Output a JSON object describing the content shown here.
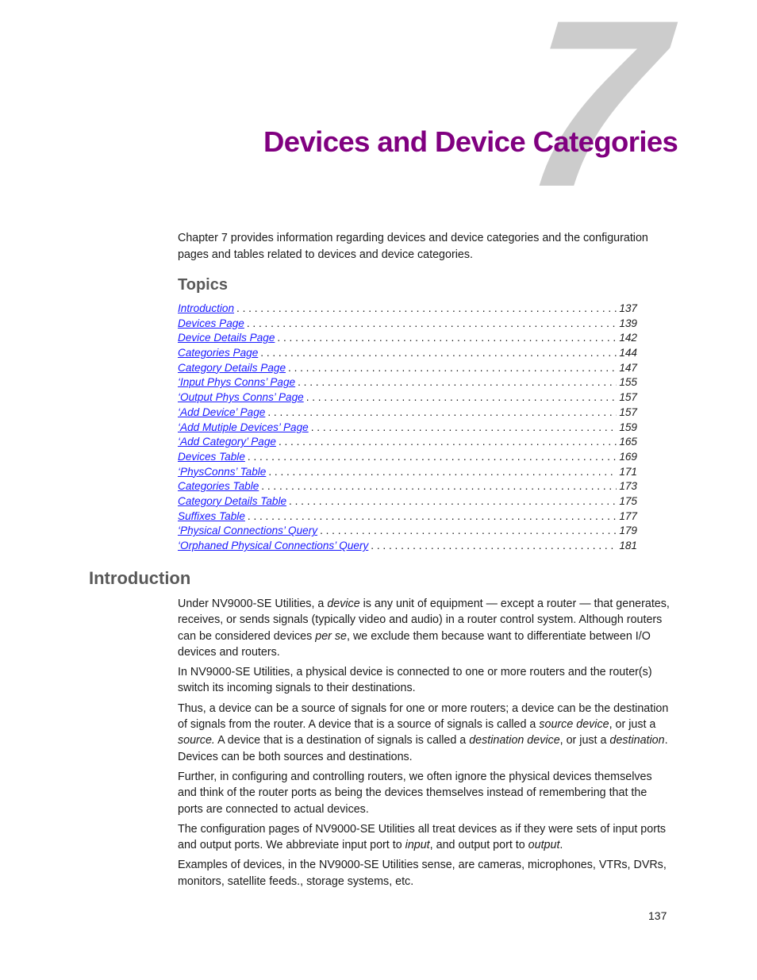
{
  "chapter": {
    "number": "7",
    "title": "Devices and Device Categories",
    "title_color": "#800080",
    "number_color": "#cccccc"
  },
  "intro": "Chapter 7 provides information regarding devices and device categories and the configuration pages and tables related to devices and device categories.",
  "topics": {
    "heading": "Topics",
    "items": [
      {
        "label": "Introduction",
        "page": "137"
      },
      {
        "label": "Devices Page",
        "page": "139"
      },
      {
        "label": "Device Details Page",
        "page": "142"
      },
      {
        "label": "Categories Page",
        "page": "144"
      },
      {
        "label": "Category Details Page",
        "page": "147"
      },
      {
        "label": "‘Input Phys Conns’ Page",
        "page": "155"
      },
      {
        "label": "‘Output Phys Conns’ Page",
        "page": "157"
      },
      {
        "label": "‘Add Device’ Page",
        "page": "157"
      },
      {
        "label": "‘Add Mutiple Devices’ Page",
        "page": "159"
      },
      {
        "label": "‘Add Category’ Page",
        "page": "165"
      },
      {
        "label": "Devices Table",
        "page": "169"
      },
      {
        "label": "‘PhysConns’ Table",
        "page": "171"
      },
      {
        "label": "Categories Table",
        "page": "173"
      },
      {
        "label": "Category Details Table",
        "page": "175"
      },
      {
        "label": "Suffixes Table",
        "page": "177"
      },
      {
        "label": "‘Physical Connections’ Query",
        "page": "179"
      },
      {
        "label": "‘Orphaned Physical Connections’ Query",
        "page": "181"
      }
    ],
    "link_color": "#1a1aff"
  },
  "introduction": {
    "heading": "Introduction",
    "p1": {
      "a": "Under NV9000-SE Utilities, a ",
      "b": "device",
      "c": " is any unit of equipment — except a router — that generates, receives, or sends signals (typically video and audio) in a router control system. Although routers can be considered devices ",
      "d": "per se",
      "e": ", we exclude them because want to differentiate between I/O devices and routers."
    },
    "p2": "In NV9000-SE Utilities, a physical device is connected to one or more routers and the router(s) switch its incoming signals to their destinations.",
    "p3": {
      "a": "Thus, a device can be a source of signals for one or more routers; a device can be the destination of signals from the router. A device that is a source of signals is called a ",
      "b": "source device",
      "c": ", or just a ",
      "d": "source.",
      "e": " A device that is a destination of signals is called a ",
      "f": "destination device",
      "g": ", or just a ",
      "h": "destination",
      "i": ". Devices can be both sources and destinations."
    },
    "p4": "Further, in configuring and controlling routers, we often ignore the physical devices themselves and think of the router ports as being the devices themselves instead of remembering that the ports are connected to actual devices.",
    "p5": {
      "a": "The configuration pages of NV9000-SE Utilities all treat devices as if they were sets of input ports and output ports. We abbreviate input port to ",
      "b": "input",
      "c": ", and output port to ",
      "d": "output",
      "e": "."
    },
    "p6": "Examples of devices, in the NV9000-SE Utilities sense, are cameras, microphones, VTRs, DVRs, monitors, satellite feeds., storage systems, etc."
  },
  "footer": {
    "page_number": "137"
  }
}
